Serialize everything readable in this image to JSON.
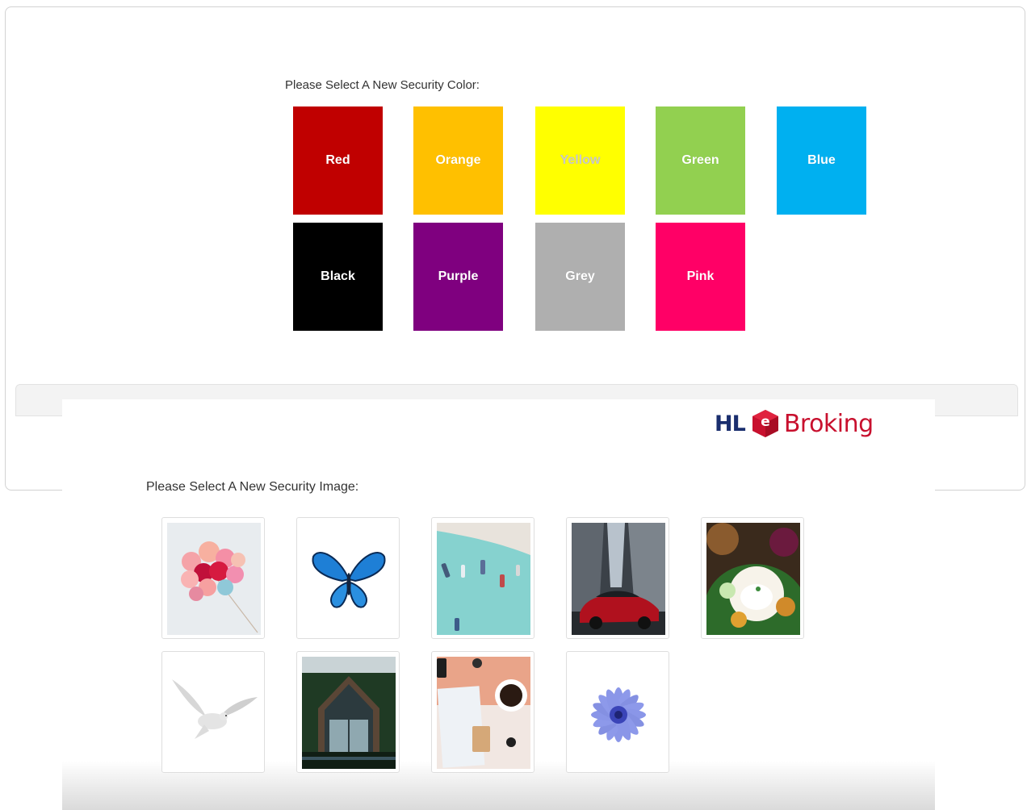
{
  "colors": {
    "prompt": "Please Select A New Security Color:",
    "items": [
      {
        "label": "Red",
        "hex": "#c00000"
      },
      {
        "label": "Orange",
        "hex": "#ffc000"
      },
      {
        "label": "Yellow",
        "hex": "#ffff00"
      },
      {
        "label": "Green",
        "hex": "#92d050"
      },
      {
        "label": "Blue",
        "hex": "#00b0f0"
      },
      {
        "label": "Black",
        "hex": "#000000"
      },
      {
        "label": "Purple",
        "hex": "#7f007f"
      },
      {
        "label": "Grey",
        "hex": "#afafaf"
      },
      {
        "label": "Pink",
        "hex": "#ff0066"
      }
    ]
  },
  "brand": {
    "logo_hl": "HL",
    "logo_e": "e",
    "logo_broking": "Broking",
    "hl_color": "#1a2e6e",
    "red_color": "#c8102e"
  },
  "images": {
    "prompt": "Please Select A New Security Image:",
    "items": [
      {
        "icon": "balloons-image"
      },
      {
        "icon": "butterfly-image"
      },
      {
        "icon": "boats-beach-image"
      },
      {
        "icon": "red-car-image"
      },
      {
        "icon": "nasi-lemak-food-image"
      },
      {
        "icon": "white-dove-image"
      },
      {
        "icon": "house-image"
      },
      {
        "icon": "coffee-desk-image"
      },
      {
        "icon": "blue-flower-image"
      }
    ]
  }
}
